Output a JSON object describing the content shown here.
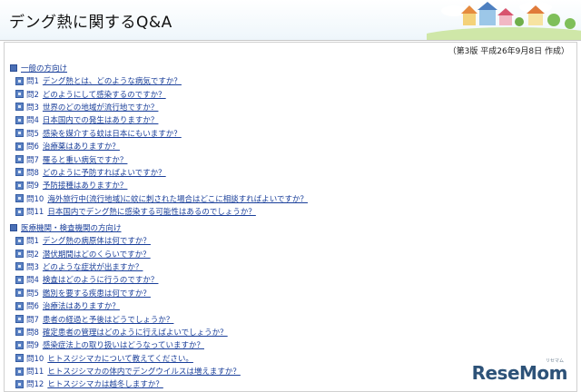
{
  "header": {
    "title": "デング熱に関するQ&A"
  },
  "edition": "（第3版 平成26年9月8日 作成）",
  "sections": [
    {
      "heading": "一般の方向け",
      "questions": [
        {
          "no": "問1",
          "text": "デング熱とは、どのような病気ですか？"
        },
        {
          "no": "問2",
          "text": "どのようにして感染するのですか？"
        },
        {
          "no": "問3",
          "text": "世界のどの地域が流行地ですか？"
        },
        {
          "no": "問4",
          "text": "日本国内での発生はありますか？"
        },
        {
          "no": "問5",
          "text": "感染を媒介する蚊は日本にもいますか？"
        },
        {
          "no": "問6",
          "text": "治療薬はありますか？"
        },
        {
          "no": "問7",
          "text": "罹ると重い病気ですか？"
        },
        {
          "no": "問8",
          "text": "どのように予防すればよいですか？"
        },
        {
          "no": "問9",
          "text": "予防接種はありますか？"
        },
        {
          "no": "問10",
          "text": "海外旅行中(流行地域)に蚊に刺された場合はどこに相談すればよいですか？"
        },
        {
          "no": "問11",
          "text": "日本国内でデング熱に感染する可能性はあるのでしょうか？"
        }
      ]
    },
    {
      "heading": "医療機関・検査機関の方向け",
      "questions": [
        {
          "no": "問1",
          "text": "デング熱の病原体は何ですか？"
        },
        {
          "no": "問2",
          "text": "潜伏期間はどのくらいですか？"
        },
        {
          "no": "問3",
          "text": "どのような症状が出ますか？"
        },
        {
          "no": "問4",
          "text": "検査はどのように行うのですか？"
        },
        {
          "no": "問5",
          "text": "鑑別を要する疾患は何ですか？"
        },
        {
          "no": "問6",
          "text": "治療法はありますか？"
        },
        {
          "no": "問7",
          "text": "患者の経過と予後はどうでしょうか？"
        },
        {
          "no": "問8",
          "text": "確定患者の管理はどのように行えばよいでしょうか？"
        },
        {
          "no": "問9",
          "text": "感染症法上の取り扱いはどうなっていますか？"
        },
        {
          "no": "問10",
          "text": "ヒトスジシマカについて教えてください。"
        },
        {
          "no": "問11",
          "text": "ヒトスジシマカの体内でデングウイルスは増えますか？"
        },
        {
          "no": "問12",
          "text": "ヒトスジシマカは越冬しますか？"
        }
      ]
    }
  ],
  "watermark": {
    "text": "ReseMom",
    "sub": "リセマム"
  }
}
